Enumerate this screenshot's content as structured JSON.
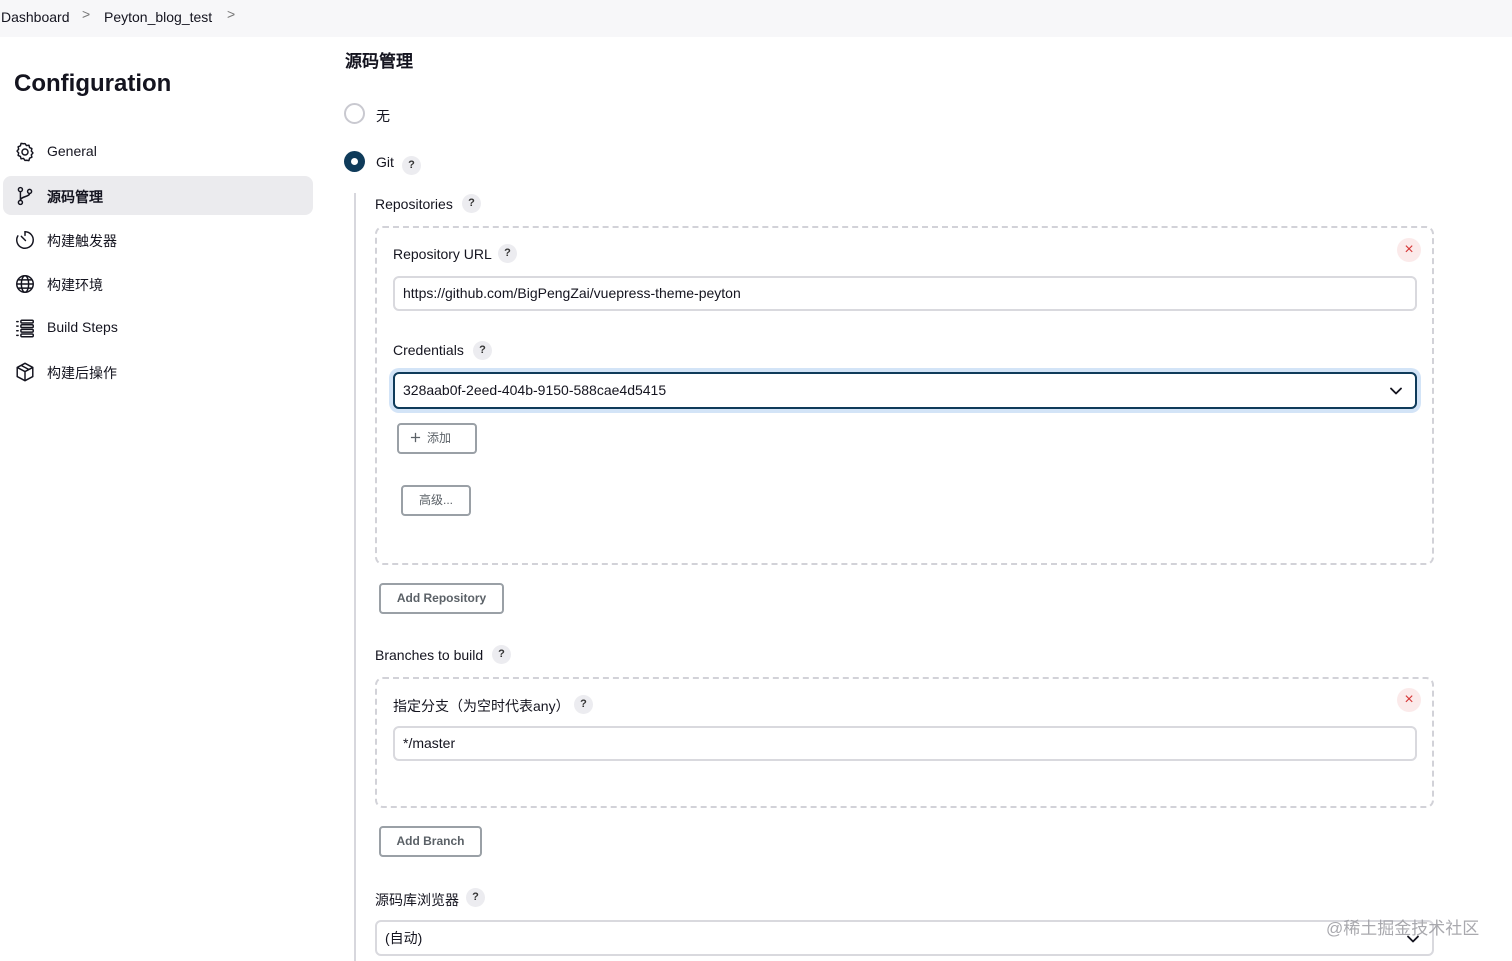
{
  "breadcrumb": {
    "items": [
      "Dashboard",
      "Peyton_blog_test"
    ],
    "separator": ">"
  },
  "sidebar": {
    "title": "Configuration",
    "items": [
      {
        "label": "General",
        "icon": "gear-icon",
        "active": false
      },
      {
        "label": "源码管理",
        "icon": "git-branch-icon",
        "active": true
      },
      {
        "label": "构建触发器",
        "icon": "timer-icon",
        "active": false
      },
      {
        "label": "构建环境",
        "icon": "globe-icon",
        "active": false
      },
      {
        "label": "Build Steps",
        "icon": "list-icon",
        "active": false
      },
      {
        "label": "构建后操作",
        "icon": "cube-icon",
        "active": false
      }
    ]
  },
  "scm": {
    "section_title": "源码管理",
    "options": [
      {
        "label": "无",
        "checked": false
      },
      {
        "label": "Git",
        "checked": true
      }
    ],
    "help_glyph": "?",
    "repositories": {
      "label": "Repositories",
      "repository_url_label": "Repository URL",
      "repository_url_value": "https://github.com/BigPengZai/vuepress-theme-peyton",
      "credentials_label": "Credentials",
      "credentials_value": "328aab0f-2eed-404b-9150-588cae4d5415",
      "add_label": "添加",
      "advanced_label": "高级...",
      "close_glyph": "×",
      "add_repository_label": "Add Repository"
    },
    "branches": {
      "label": "Branches to build",
      "branch_spec_label": "指定分支（为空时代表any）",
      "branch_spec_value": "*/master",
      "close_glyph": "×",
      "add_branch_label": "Add Branch"
    },
    "browser": {
      "label": "源码库浏览器",
      "value": "(自动)"
    }
  },
  "watermark": "@稀土掘金技术社区",
  "colors": {
    "accent": "#0f3b5a",
    "focus_ring": "#d3e4f7",
    "close_red": "#d63636",
    "active_bg": "#ebebee"
  }
}
